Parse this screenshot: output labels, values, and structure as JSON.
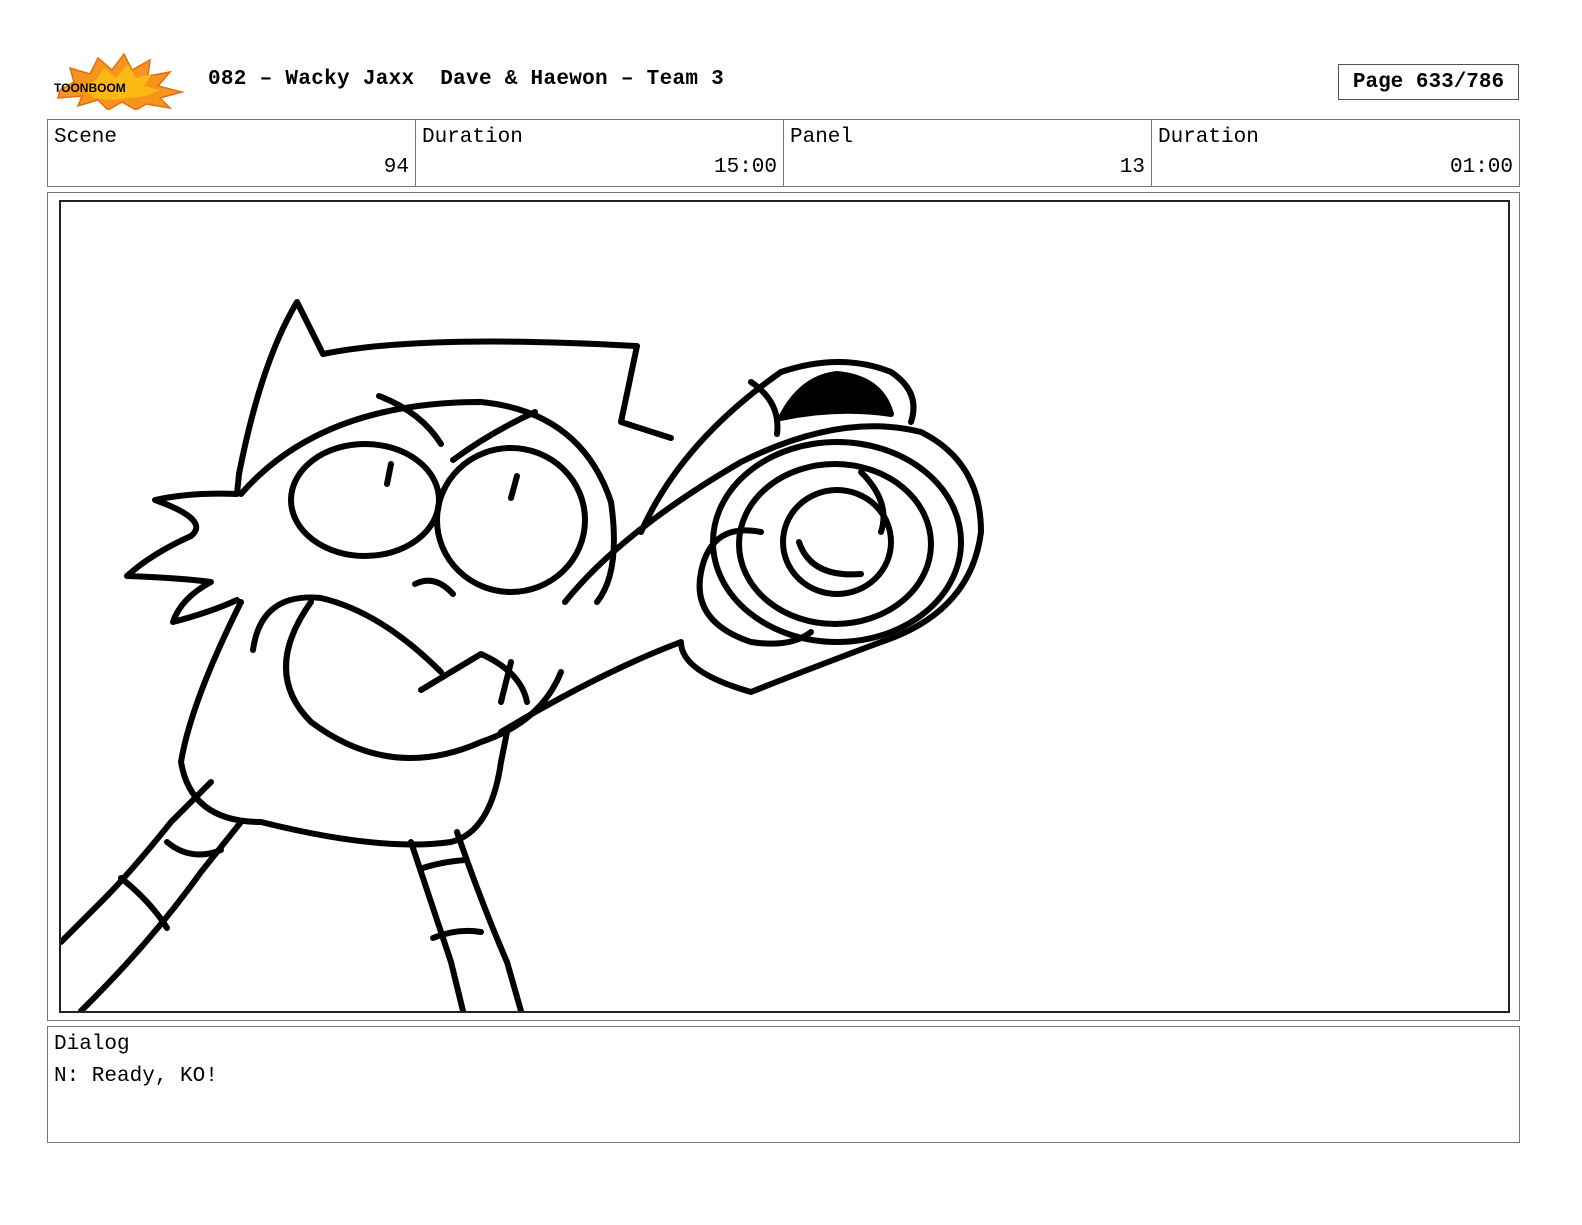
{
  "header": {
    "title": "082 – Wacky Jaxx  Dave & Haewon – Team 3",
    "page": "Page 633/786"
  },
  "logo": {
    "icon": "toonboom-logo-icon",
    "text": "TOONBOOM",
    "colors": {
      "burst": "#F7941D",
      "burst_inner": "#FDB913",
      "outline": "#000000"
    }
  },
  "info": {
    "scene_label": "Scene",
    "scene_value": "94",
    "scene_duration_label": "Duration",
    "scene_duration_value": "15:00",
    "panel_label": "Panel",
    "panel_value": "13",
    "panel_duration_label": "Duration",
    "panel_duration_value": "01:00"
  },
  "panel": {
    "image": "storyboard-sketch-character-aiming"
  },
  "dialog": {
    "label": "Dialog",
    "text": "N: Ready, KO!"
  }
}
